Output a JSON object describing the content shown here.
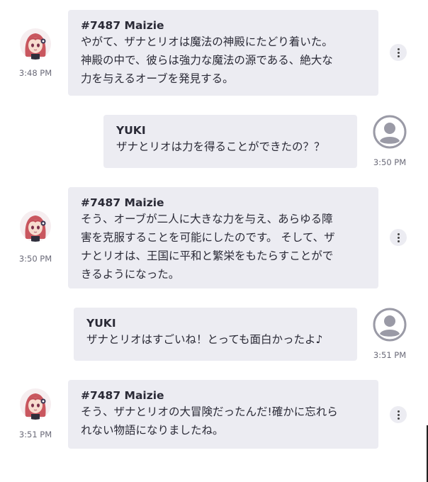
{
  "messages": [
    {
      "sender": "#7487 Maizie",
      "text": "やがて、ザナとリオは魔法の神殿にたどり着いた。\n神殿の中で、彼らは強力な魔法の源である、絶大な\n力を与えるオーブを発見する。",
      "time": "3:48 PM",
      "side": "left"
    },
    {
      "sender": "YUKI",
      "text": "ザナとリオは力を得ることができたの？？",
      "time": "3:50 PM",
      "side": "right"
    },
    {
      "sender": "#7487 Maizie",
      "text": "そう、オーブが二人に大きな力を与え、あらゆる障\n害を克服することを可能にしたのです。 そして、ザ\nナとリオは、王国に平和と繁栄をもたらすことがで\nきるようになった。",
      "time": "3:50 PM",
      "side": "left"
    },
    {
      "sender": "YUKI",
      "text": "ザナとリオはすごいね！とっても面白かったよ♪",
      "time": "3:51 PM",
      "side": "right"
    },
    {
      "sender": "#7487 Maizie",
      "text": "そう、ザナとリオの大冒険だったんだ!確かに忘れら\nれない物語になりましたね。",
      "time": "3:51 PM",
      "side": "left"
    }
  ],
  "icons": {
    "bot_avatar": "anime-girl-avatar-icon",
    "user_avatar": "default-user-avatar-icon",
    "menu": "more-vertical-icon"
  },
  "colors": {
    "bubble": "#ececf2",
    "text": "#2a2a36",
    "timestamp": "#6a6a78",
    "avatar_gray": "#9a9aa6"
  }
}
